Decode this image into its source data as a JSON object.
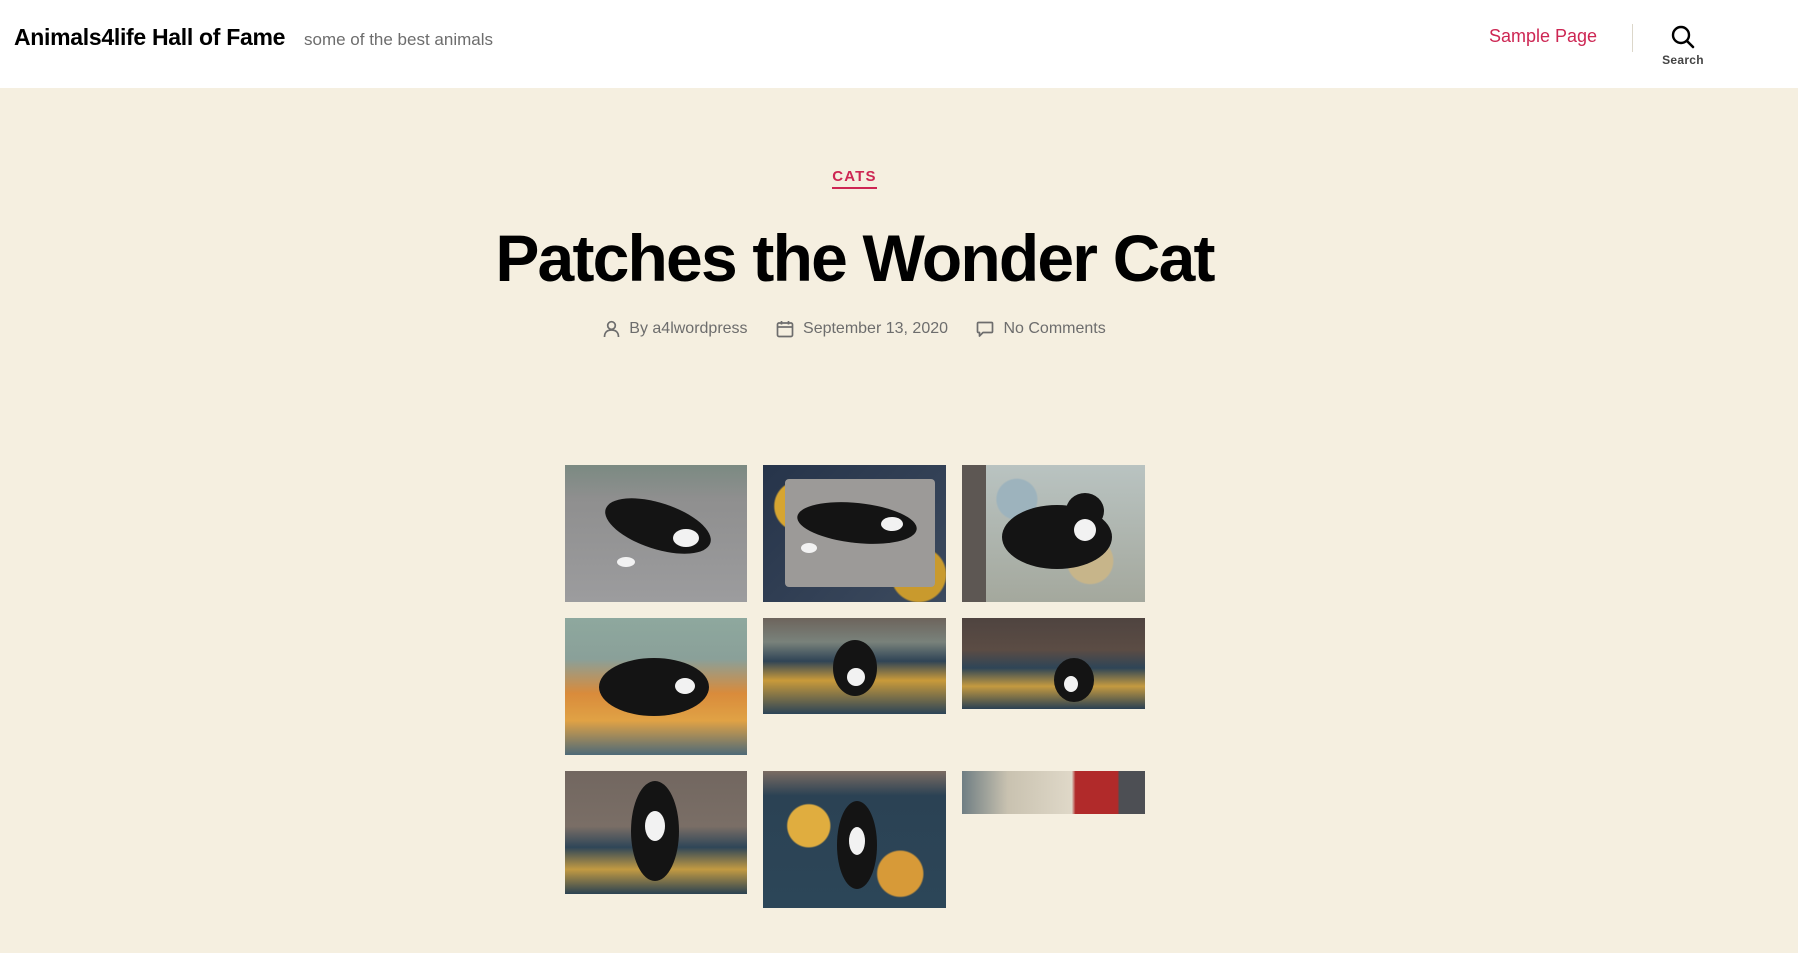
{
  "header": {
    "site_title": "Animals4life Hall of Fame",
    "site_description": "some of the best animals",
    "nav_link": "Sample Page",
    "search_label": "Search"
  },
  "post": {
    "category": "CATS",
    "title": "Patches the Wonder Cat",
    "author": "By a4lwordpress",
    "date": "September 13, 2020",
    "comments": "No Comments"
  },
  "gallery": {
    "images": [
      {
        "name": "gallery-image-1",
        "subject": "cat lying on gray cushion"
      },
      {
        "name": "gallery-image-2",
        "subject": "cat lying on gray ottoman"
      },
      {
        "name": "gallery-image-3",
        "subject": "cat on floral chair"
      },
      {
        "name": "gallery-image-4",
        "subject": "cat on colorful rug"
      },
      {
        "name": "gallery-image-5",
        "subject": "cat sitting on rug"
      },
      {
        "name": "gallery-image-6",
        "subject": "cat on rug near sofa"
      },
      {
        "name": "gallery-image-7",
        "subject": "cat sitting near armchair"
      },
      {
        "name": "gallery-image-8",
        "subject": "cat sitting on floral rug"
      },
      {
        "name": "gallery-image-9",
        "subject": "cropped room photo"
      }
    ]
  },
  "colors": {
    "accent": "#cd2653",
    "background": "#f5efe0",
    "header_bg": "#ffffff",
    "meta_text": "#6d6d6d"
  }
}
